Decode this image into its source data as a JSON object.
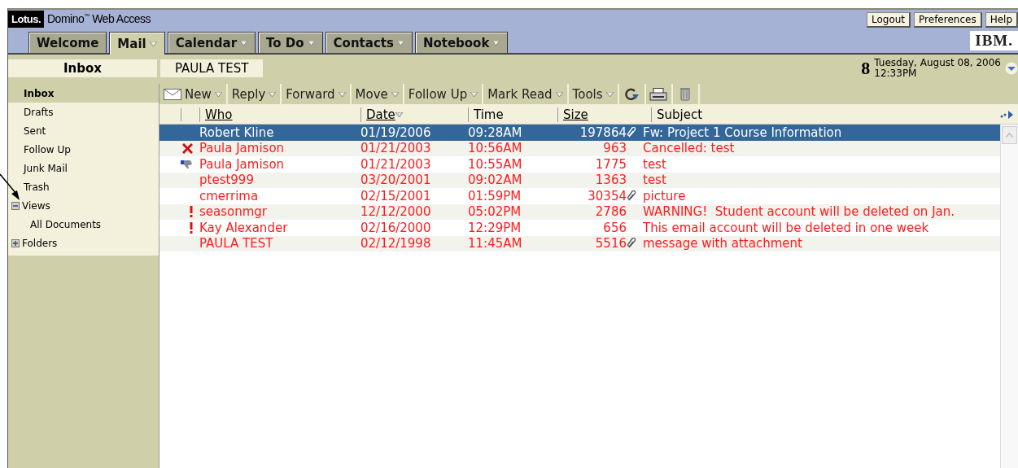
{
  "brand": {
    "logo": "Lotus.",
    "product": "Domino$^{™}$ Web Access"
  },
  "top_links": [
    "Logout",
    "Preferences",
    "Help"
  ],
  "tabs": [
    {
      "label": "Welcome",
      "selected": false,
      "dropdown": false
    },
    {
      "label": "Mail",
      "selected": true,
      "dropdown": true
    },
    {
      "label": "Calendar",
      "selected": false,
      "dropdown": true
    },
    {
      "label": "To Do",
      "selected": false,
      "dropdown": true
    },
    {
      "label": "Contacts",
      "selected": false,
      "dropdown": true
    },
    {
      "label": "Notebook",
      "selected": false,
      "dropdown": true
    }
  ],
  "ibm_logo": "IBM.",
  "view_title": "Inbox",
  "user_name": "PAULA TEST",
  "date_panel": {
    "day": "8",
    "date": "Tuesday, August 08, 2006",
    "time": "12:33PM"
  },
  "sidebar": {
    "items": [
      {
        "label": "Inbox",
        "selected": true
      },
      {
        "label": "Drafts",
        "selected": false
      },
      {
        "label": "Sent",
        "selected": false
      },
      {
        "label": "Follow Up",
        "selected": false
      },
      {
        "label": "Junk Mail",
        "selected": false
      },
      {
        "label": "Trash",
        "selected": false
      },
      {
        "label": "Views",
        "selected": false,
        "expanded": true,
        "children": [
          {
            "label": "All Documents",
            "selected": false
          }
        ]
      },
      {
        "label": "Folders",
        "selected": false,
        "expanded": false
      }
    ]
  },
  "toolbar": {
    "buttons": [
      "New",
      "Reply",
      "Forward",
      "Move",
      "Follow Up",
      "Mark Read",
      "Tools"
    ]
  },
  "table": {
    "columns": [
      "Who",
      "Date",
      "Time",
      "Size",
      "Subject"
    ],
    "rows": [
      {
        "kind": "plain",
        "who": "Robert Kline",
        "date": "01/19/2006",
        "time": "09:28AM",
        "size": "197864",
        "attachment": true,
        "subject": "Fw: Project 1 Course Information",
        "selected": true,
        "unread": true
      },
      {
        "kind": "cancelled",
        "who": "Paula Jamison",
        "date": "01/21/2003",
        "time": "10:56AM",
        "size": "963",
        "attachment": false,
        "subject": "Cancelled: test",
        "selected": false,
        "unread": true
      },
      {
        "kind": "declined",
        "who": "Paula Jamison",
        "date": "01/21/2003",
        "time": "10:55AM",
        "size": "1775",
        "attachment": false,
        "subject": "test",
        "selected": false,
        "unread": true
      },
      {
        "kind": "plain",
        "who": "ptest999",
        "date": "03/20/2001",
        "time": "09:02AM",
        "size": "1363",
        "attachment": false,
        "subject": "test",
        "selected": false,
        "unread": true
      },
      {
        "kind": "plain",
        "who": "cmerrima",
        "date": "02/15/2001",
        "time": "01:59PM",
        "size": "30354",
        "attachment": true,
        "subject": "picture",
        "selected": false,
        "unread": true
      },
      {
        "kind": "urgent",
        "who": "seasonmgr",
        "date": "12/12/2000",
        "time": "05:02PM",
        "size": "2786",
        "attachment": false,
        "subject": "WARNING!  Student account will be deleted on Jan.",
        "selected": false,
        "unread": true
      },
      {
        "kind": "urgent",
        "who": "Kay Alexander",
        "date": "02/16/2000",
        "time": "12:29PM",
        "size": "656",
        "attachment": false,
        "subject": "This email account will be deleted in one week",
        "selected": false,
        "unread": true
      },
      {
        "kind": "plain",
        "who": "PAULA TEST",
        "date": "02/12/1998",
        "time": "11:45AM",
        "size": "5516",
        "attachment": true,
        "subject": "message with attachment",
        "selected": false,
        "unread": true
      }
    ]
  }
}
